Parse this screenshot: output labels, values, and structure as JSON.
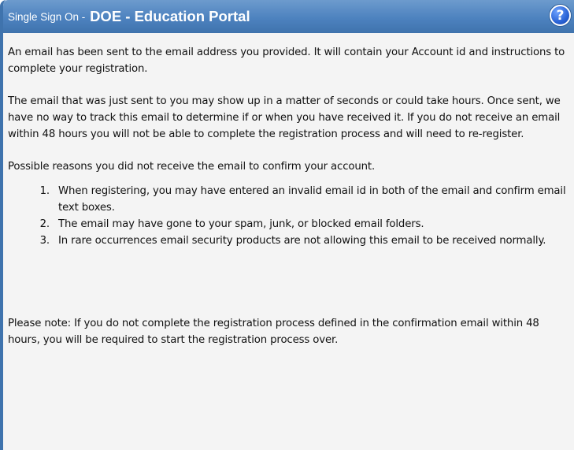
{
  "header": {
    "prefix": "Single Sign On - ",
    "title": "DOE - Education Portal",
    "help_glyph": "?",
    "help_icon": "help-question-icon",
    "colors": {
      "titlebar": "#4d82bf",
      "help_button": "#2a63d6",
      "content_background": "#f4f4f4"
    }
  },
  "body": {
    "paragraph_1": "An email has been sent to the email address you provided. It will contain your Account id and instructions to complete your registration.",
    "paragraph_2": "The email that was just sent to you may show up in a matter of seconds or could take hours. Once sent, we have no way to track this email to determine if or when you have received it. If you do not receive an email within 48 hours you will not be able to complete the registration process and will need to re-register.",
    "paragraph_3": "Possible reasons you did not receive the email to confirm your account.",
    "reasons": [
      {
        "number": "1.",
        "text": "When registering, you may have entered an invalid email id in both of the email and confirm email text boxes."
      },
      {
        "number": "2.",
        "text": "The email may have gone to your spam, junk, or blocked email folders."
      },
      {
        "number": "3.",
        "text": "In rare occurrences email security products are not allowing this email to be received normally."
      }
    ],
    "paragraph_4": "Please note: If you do not complete the registration process defined in the confirmation email within 48 hours, you will be required to start the registration process over."
  }
}
